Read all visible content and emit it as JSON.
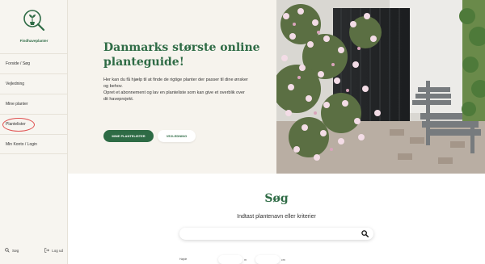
{
  "brand": {
    "logo_text": "Findhaveplanter"
  },
  "sidebar": {
    "items": [
      {
        "label": "Forside / Søg"
      },
      {
        "label": "Vejledning"
      },
      {
        "label": "Mine planter"
      },
      {
        "label": "Plantelister"
      },
      {
        "label": "Min Konto / Login"
      }
    ],
    "search_label": "Søg",
    "logout_label": "Log ud"
  },
  "hero": {
    "title": "Danmarks største online planteguide!",
    "paragraph1": "Her kan du få hjælp til at finde de rigtige planter der passer til dine ønsker og behov.",
    "paragraph2": "Opret et abonnement og lav en planteliste som kan give et overblik over dit haveprojekt.",
    "primary_button": "MINE PLANTELISTER",
    "secondary_button": "VEJLEDNING"
  },
  "search": {
    "title": "Søg",
    "subtitle": "Indtast plantenavn eller kriterier",
    "placeholder": "",
    "filter_label": "Højde",
    "unit1": "m",
    "unit2": "cm"
  },
  "colors": {
    "brand_green": "#2e6b45",
    "highlight_ring": "#e05050",
    "sidebar_bg": "#f7f5f0"
  }
}
